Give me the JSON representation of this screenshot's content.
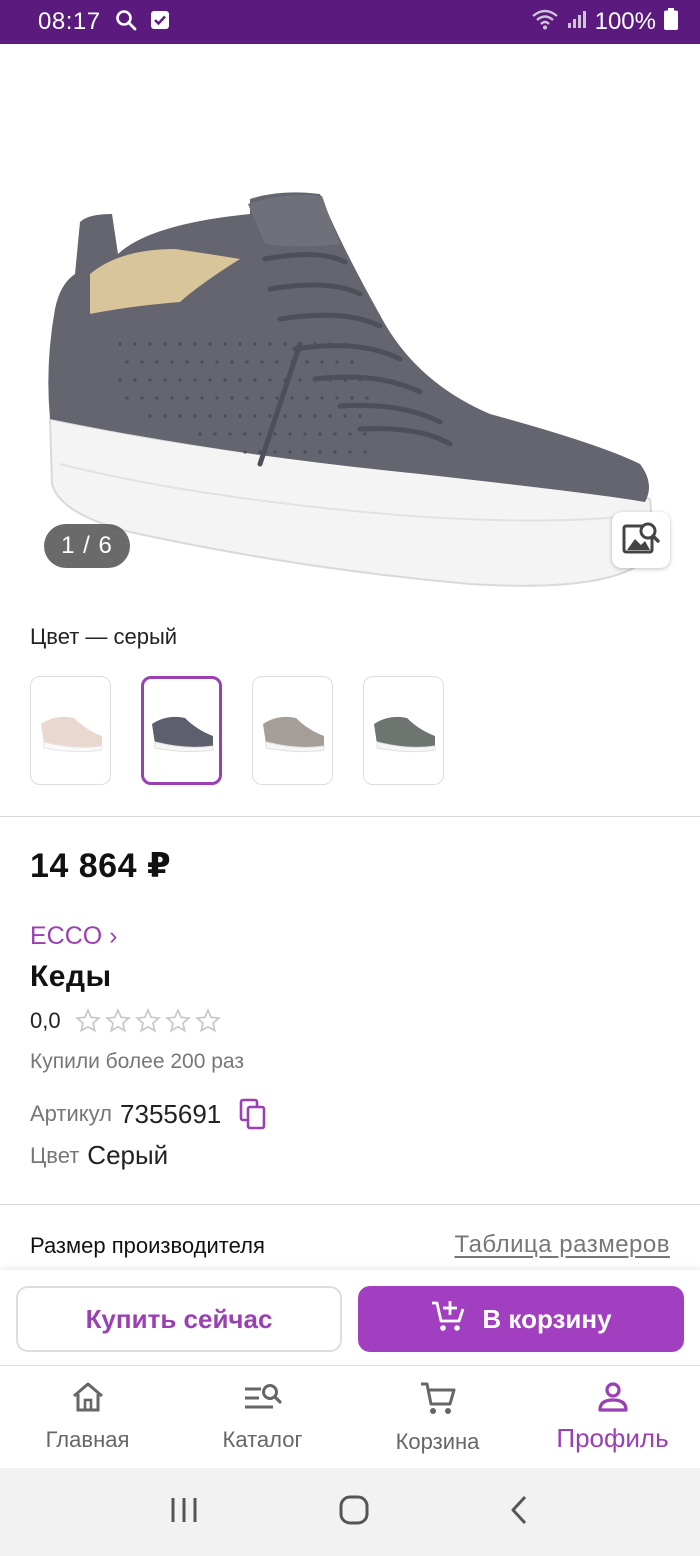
{
  "status_bar": {
    "time": "08:17",
    "battery": "100%"
  },
  "gallery": {
    "page_counter": "1 / 6"
  },
  "color_selector": {
    "title": "Цвет — серый",
    "swatches": [
      {
        "name": "beige",
        "color": "#e8d8cf"
      },
      {
        "name": "dark-grey",
        "color": "#5d5f6d",
        "selected": true
      },
      {
        "name": "taupe",
        "color": "#a59d98"
      },
      {
        "name": "green-grey",
        "color": "#6e7470"
      }
    ]
  },
  "product": {
    "price": "14 864 ₽",
    "brand": "ECCO ›",
    "name": "Кеды",
    "rating": "0,0",
    "stars_filled": 0,
    "stars_total": 5,
    "bought": "Купили более 200 раз",
    "article_label": "Артикул",
    "article_value": "7355691",
    "color_label": "Цвет",
    "color_value": "Серый"
  },
  "size": {
    "label": "Размер производителя",
    "table_link": "Таблица размеров"
  },
  "actions": {
    "buy_now": "Купить сейчас",
    "add_to_cart": "В корзину"
  },
  "bottom_nav": {
    "items": [
      {
        "label": "Главная",
        "icon": "home-icon"
      },
      {
        "label": "Каталог",
        "icon": "catalog-search-icon"
      },
      {
        "label": "Корзина",
        "icon": "cart-icon"
      },
      {
        "label": "Профиль",
        "icon": "profile-icon",
        "active": true
      }
    ]
  },
  "colors": {
    "brand_purple": "#9b3fb5",
    "status_bar": "#5a1a7e",
    "button_purple": "#a23fc0"
  }
}
